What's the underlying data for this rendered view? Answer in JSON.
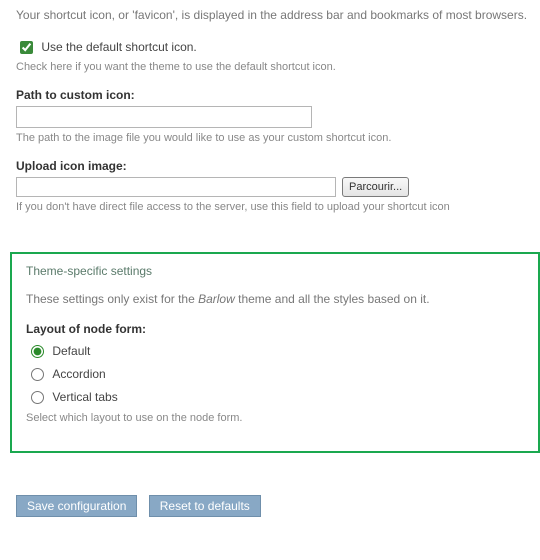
{
  "favicon": {
    "intro": "Your shortcut icon, or 'favicon', is displayed in the address bar and bookmarks of most browsers.",
    "use_default_label": "Use the default shortcut icon.",
    "use_default_checked": true,
    "use_default_desc": "Check here if you want the theme to use the default shortcut icon.",
    "path_label": "Path to custom icon:",
    "path_value": "",
    "path_desc": "The path to the image file you would like to use as your custom shortcut icon.",
    "upload_label": "Upload icon image:",
    "browse_label": "Parcourir...",
    "upload_desc": "If you don't have direct file access to the server, use this field to upload your shortcut icon"
  },
  "theme": {
    "legend": "Theme-specific settings",
    "intro_prefix": "These settings only exist for the ",
    "intro_theme_name": "Barlow",
    "intro_suffix": " theme and all the styles based on it.",
    "layout_label": "Layout of node form:",
    "options": [
      "Default",
      "Accordion",
      "Vertical tabs"
    ],
    "selected": "Default",
    "layout_desc": "Select which layout to use on the node form."
  },
  "actions": {
    "save": "Save configuration",
    "reset": "Reset to defaults"
  }
}
